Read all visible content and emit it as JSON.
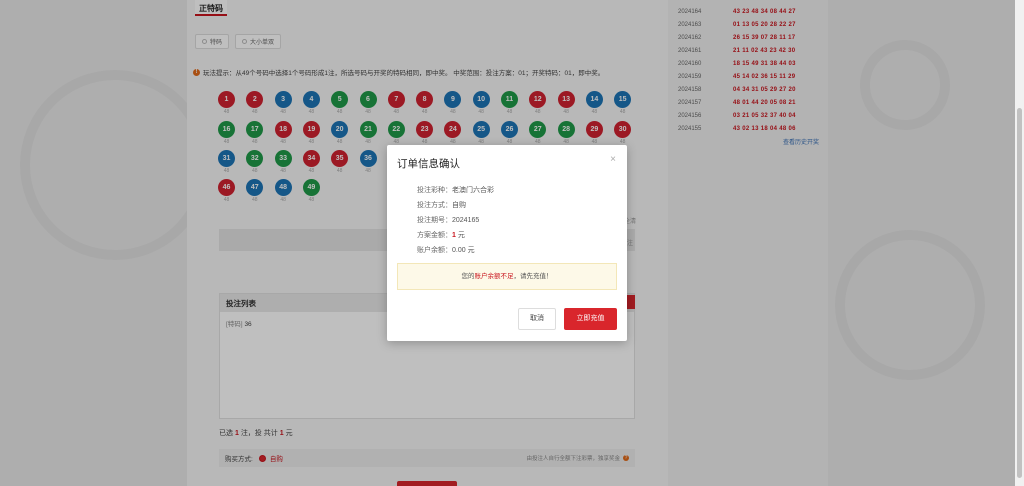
{
  "tab": {
    "label": "正特码"
  },
  "modes": [
    {
      "label": "特码"
    },
    {
      "label": "大小单双"
    }
  ],
  "hint": {
    "text": "玩法提示：从49个号码中选择1个号码形成1注，所选号码与开奖的特码相同，即中奖。 中奖范围：投注方案：01；开奖特码：01，即中奖。"
  },
  "balls": [
    {
      "n": "1",
      "c": "red"
    },
    {
      "n": "2",
      "c": "red"
    },
    {
      "n": "3",
      "c": "blue"
    },
    {
      "n": "4",
      "c": "blue"
    },
    {
      "n": "5",
      "c": "green"
    },
    {
      "n": "6",
      "c": "green"
    },
    {
      "n": "7",
      "c": "red"
    },
    {
      "n": "8",
      "c": "red"
    },
    {
      "n": "9",
      "c": "blue"
    },
    {
      "n": "10",
      "c": "blue"
    },
    {
      "n": "11",
      "c": "green"
    },
    {
      "n": "12",
      "c": "red"
    },
    {
      "n": "13",
      "c": "red"
    },
    {
      "n": "14",
      "c": "blue"
    },
    {
      "n": "15",
      "c": "blue"
    },
    {
      "n": "16",
      "c": "green"
    },
    {
      "n": "17",
      "c": "green"
    },
    {
      "n": "18",
      "c": "red"
    },
    {
      "n": "19",
      "c": "red"
    },
    {
      "n": "20",
      "c": "blue"
    },
    {
      "n": "21",
      "c": "green"
    },
    {
      "n": "22",
      "c": "green"
    },
    {
      "n": "23",
      "c": "red"
    },
    {
      "n": "24",
      "c": "red"
    },
    {
      "n": "25",
      "c": "blue"
    },
    {
      "n": "26",
      "c": "blue"
    },
    {
      "n": "27",
      "c": "green"
    },
    {
      "n": "28",
      "c": "green"
    },
    {
      "n": "29",
      "c": "red"
    },
    {
      "n": "30",
      "c": "red"
    },
    {
      "n": "31",
      "c": "blue"
    },
    {
      "n": "32",
      "c": "green"
    },
    {
      "n": "33",
      "c": "green"
    },
    {
      "n": "34",
      "c": "red"
    },
    {
      "n": "35",
      "c": "red"
    },
    {
      "n": "36",
      "c": "blue"
    },
    {
      "n": "46",
      "c": "red"
    },
    {
      "n": "47",
      "c": "blue"
    },
    {
      "n": "48",
      "c": "blue"
    },
    {
      "n": "49",
      "c": "green"
    }
  ],
  "odds": "48",
  "list": {
    "title": "投注列表",
    "item_tag": "[特码]",
    "item_value": "36"
  },
  "summary": {
    "pre": "已选",
    "count": "1",
    "mid": "注，投 共计",
    "amount": "1",
    "unit": "元"
  },
  "buy": {
    "label": "购买方式:",
    "option": "自购",
    "note": "由投注人自行全额下注彩票，独享奖金"
  },
  "history": [
    {
      "p": "2024164",
      "n": "43 23 48 34 08 44 27"
    },
    {
      "p": "2024163",
      "n": "01 13 05 20 28 22 27"
    },
    {
      "p": "2024162",
      "n": "26 15 39 07 28 11 17"
    },
    {
      "p": "2024161",
      "n": "21 11 02 43 23 42 30"
    },
    {
      "p": "2024160",
      "n": "18 15 49 31 38 44 03"
    },
    {
      "p": "2024159",
      "n": "45 14 02 36 15 11 29"
    },
    {
      "p": "2024158",
      "n": "04 34 31 05 29 27 20"
    },
    {
      "p": "2024157",
      "n": "48 01 44 20 05 08 21"
    },
    {
      "p": "2024156",
      "n": "03 21 05 32 37 40 04"
    },
    {
      "p": "2024155",
      "n": "43 02 13 18 04 48 06"
    }
  ],
  "history_link": "查看历史开奖",
  "side_labels": {
    "a": "全清",
    "b": "注"
  },
  "modal": {
    "title": "订单信息确认",
    "close": "×",
    "lottery_k": "投注彩种：",
    "lottery_v": "老澳门六合彩",
    "method_k": "投注方式：",
    "method_v": "自购",
    "period_k": "投注期号：",
    "period_v": "2024165",
    "amount_k": "方案金额：",
    "amount_v": "1",
    "amount_unit": " 元",
    "balance_k": "账户余额：",
    "balance_v": "0.00 元",
    "warn_pre": "您的",
    "warn_em": "账户余额不足",
    "warn_post": "，请先充值！",
    "cancel": "取消",
    "ok": "立即充值"
  }
}
